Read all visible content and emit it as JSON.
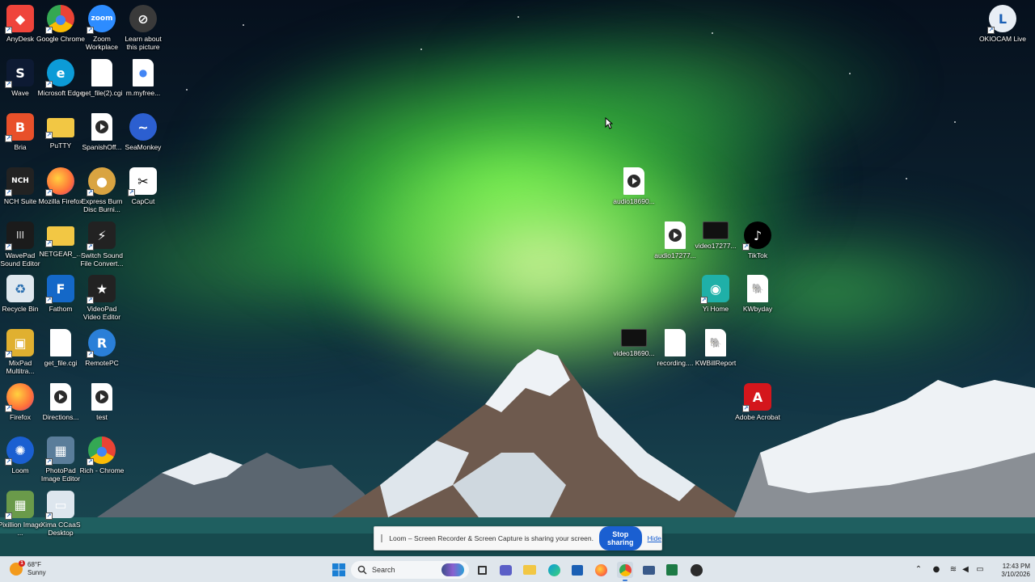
{
  "desktop": {
    "icons": [
      {
        "label": "AnyDesk",
        "icon": "anydesk-icon",
        "color": "#ef443b",
        "glyph": "◆"
      },
      {
        "label": "Google Chrome",
        "icon": "chrome-icon",
        "color": "#4285f4",
        "glyph": "●"
      },
      {
        "label": "Zoom Workplace",
        "icon": "zoom-icon",
        "color": "#2d8cff",
        "glyph": "zoom"
      },
      {
        "label": "Learn about this picture",
        "icon": "learn-about-picture-icon",
        "color": "#3a3a3a",
        "glyph": "⊘"
      },
      {
        "label": "Wave",
        "icon": "wave-icon",
        "color": "#0d1a33",
        "glyph": "S"
      },
      {
        "label": "Microsoft Edge",
        "icon": "edge-icon",
        "color": "#0c9bd7",
        "glyph": "e"
      },
      {
        "label": "get_file(2).cgi",
        "icon": "file-icon",
        "color": "#ffffff",
        "glyph": ""
      },
      {
        "label": "m.myfree...",
        "icon": "chrome-html-icon",
        "color": "#ffffff",
        "glyph": "●"
      },
      {
        "label": "Bria",
        "icon": "bria-icon",
        "color": "#e8502a",
        "glyph": "B"
      },
      {
        "label": "PuTTY",
        "icon": "putty-folder-icon",
        "color": "#f2c744",
        "glyph": ""
      },
      {
        "label": "SpanishOff...",
        "icon": "audio-file-icon",
        "color": "#ffffff",
        "glyph": ""
      },
      {
        "label": "SeaMonkey",
        "icon": "seamonkey-icon",
        "color": "#2c5fd0",
        "glyph": "~"
      },
      {
        "label": "NCH Suite",
        "icon": "nch-suite-icon",
        "color": "#222222",
        "glyph": "NCH"
      },
      {
        "label": "Mozilla Firefox",
        "icon": "firefox-icon",
        "color": "#ff7139",
        "glyph": "●"
      },
      {
        "label": "Express Burn Disc Burni...",
        "icon": "express-burn-icon",
        "color": "#d9a441",
        "glyph": "●"
      },
      {
        "label": "CapCut",
        "icon": "capcut-icon",
        "color": "#ffffff",
        "glyph": "✂"
      },
      {
        "label": "WavePad Sound Editor",
        "icon": "wavepad-icon",
        "color": "#1b1b1b",
        "glyph": "|||"
      },
      {
        "label": "NETGEAR_...",
        "icon": "netgear-folder-icon",
        "color": "#f2c744",
        "glyph": ""
      },
      {
        "label": "Switch Sound File Convert...",
        "icon": "switch-converter-icon",
        "color": "#222222",
        "glyph": "⚡"
      },
      {
        "label": "Recycle Bin",
        "icon": "recycle-bin-icon",
        "color": "#dfe8ef",
        "glyph": "♻"
      },
      {
        "label": "Fathom",
        "icon": "fathom-icon",
        "color": "#1468c8",
        "glyph": "F"
      },
      {
        "label": "VideoPad Video Editor",
        "icon": "videopad-icon",
        "color": "#222222",
        "glyph": "★"
      },
      {
        "label": "MixPad Multitra...",
        "icon": "mixpad-icon",
        "color": "#e0b030",
        "glyph": "▣"
      },
      {
        "label": "get_file.cgi",
        "icon": "file-icon",
        "color": "#ffffff",
        "glyph": ""
      },
      {
        "label": "RemotePC",
        "icon": "remotepc-icon",
        "color": "#2a7fd8",
        "glyph": "R"
      },
      {
        "label": "Firefox",
        "icon": "firefox-icon",
        "color": "#ff7139",
        "glyph": "●"
      },
      {
        "label": "Directions...",
        "icon": "audio-file-icon",
        "color": "#ffffff",
        "glyph": ""
      },
      {
        "label": "test",
        "icon": "audio-file-icon",
        "color": "#ffffff",
        "glyph": ""
      },
      {
        "label": "Loom",
        "icon": "loom-icon",
        "color": "#1a5fd1",
        "glyph": "✺"
      },
      {
        "label": "PhotoPad Image Editor",
        "icon": "photopad-icon",
        "color": "#5a7d9a",
        "glyph": "▦"
      },
      {
        "label": "Rich - Chrome",
        "icon": "chrome-profile-icon",
        "color": "#4285f4",
        "glyph": "●"
      },
      {
        "label": "Pixillion Image ...",
        "icon": "pixillion-icon",
        "color": "#6a9a4a",
        "glyph": "▦"
      },
      {
        "label": "Xima CCaaS Desktop",
        "icon": "xima-icon",
        "color": "#dde6ee",
        "glyph": "▭"
      },
      {
        "label": "OKIOCAM Live",
        "icon": "okiocam-icon",
        "color": "#e8eef5",
        "glyph": "L"
      },
      {
        "label": "audio18690...",
        "icon": "audio-file-icon",
        "color": "#ffffff",
        "glyph": ""
      },
      {
        "label": "audio17277...",
        "icon": "audio-file-icon",
        "color": "#ffffff",
        "glyph": ""
      },
      {
        "label": "video17277...",
        "icon": "video-file-icon",
        "color": "#111111",
        "glyph": ""
      },
      {
        "label": "TikTok",
        "icon": "tiktok-icon",
        "color": "#000000",
        "glyph": "♪"
      },
      {
        "label": "Yi Home",
        "icon": "yi-home-icon",
        "color": "#1fb0a8",
        "glyph": "◉"
      },
      {
        "label": "KWbyday",
        "icon": "kw-php-file-icon",
        "color": "#ffffff",
        "glyph": "🐘"
      },
      {
        "label": "video18690...",
        "icon": "video-file-icon",
        "color": "#111111",
        "glyph": ""
      },
      {
        "label": "recording....",
        "icon": "file-icon",
        "color": "#ffffff",
        "glyph": ""
      },
      {
        "label": "KWBillReport",
        "icon": "kw-php-file-icon",
        "color": "#ffffff",
        "glyph": "🐘"
      },
      {
        "label": "Adobe Acrobat",
        "icon": "adobe-acrobat-icon",
        "color": "#d4161c",
        "glyph": "A"
      }
    ]
  },
  "loom_bar": {
    "message": "Loom – Screen Recorder & Screen Capture is sharing your screen.",
    "stop_label": "Stop sharing",
    "hide_label": "Hide"
  },
  "taskbar": {
    "weather_temp": "68°F",
    "weather_desc": "Sunny",
    "weather_badge": "1",
    "search_placeholder": "Search",
    "time": "12:43 PM",
    "date": "3/10/2026",
    "accent": "#3a7bd5"
  }
}
